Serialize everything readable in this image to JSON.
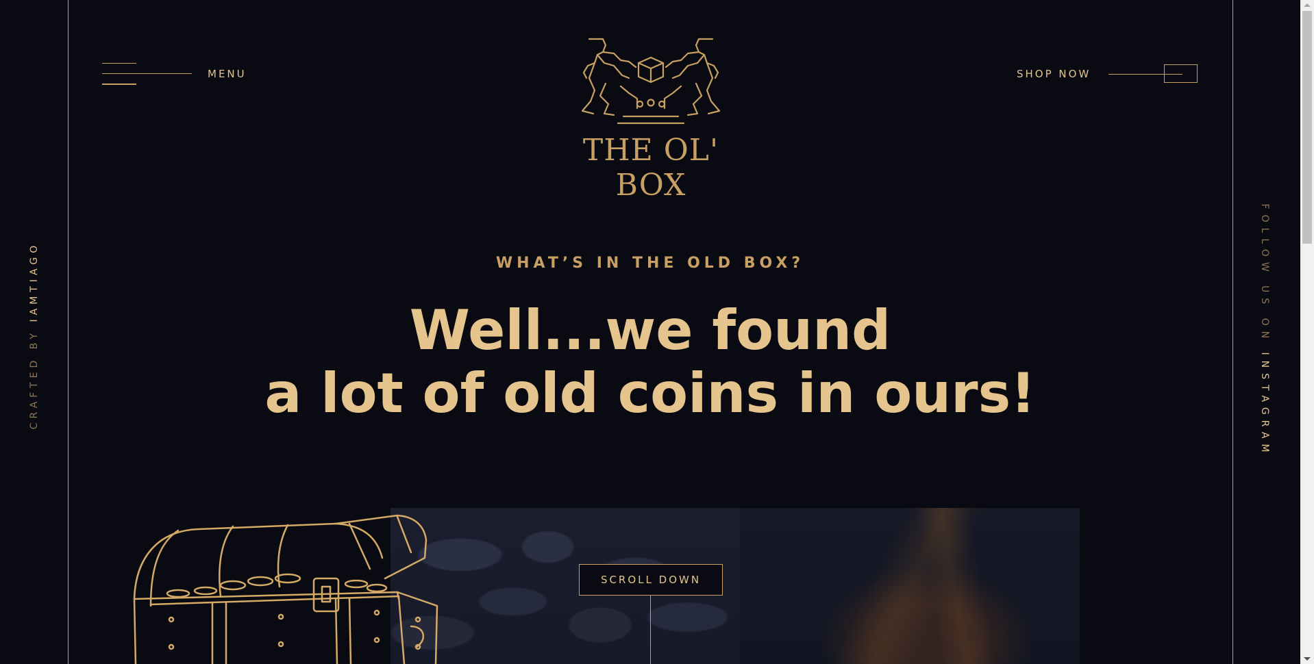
{
  "header": {
    "menu_label": "MENU",
    "shop_label": "SHOP NOW",
    "logo_text": "THE OL' BOX"
  },
  "side": {
    "left_prefix": "CRAFTED BY ",
    "left_name": "IAMTIAGO",
    "right_prefix": "FOLLOW US ON ",
    "right_name": "INSTAGRAM"
  },
  "hero": {
    "eyebrow": "WHAT’S IN THE OLD BOX?",
    "headline_line1": "Well...we found",
    "headline_line2": "a lot of old coins in ours!"
  },
  "scroll_label": "SCROLL DOWN",
  "colors": {
    "background": "#0a0b12",
    "gold": "#c9a063",
    "gold_light": "#e6c48d"
  }
}
